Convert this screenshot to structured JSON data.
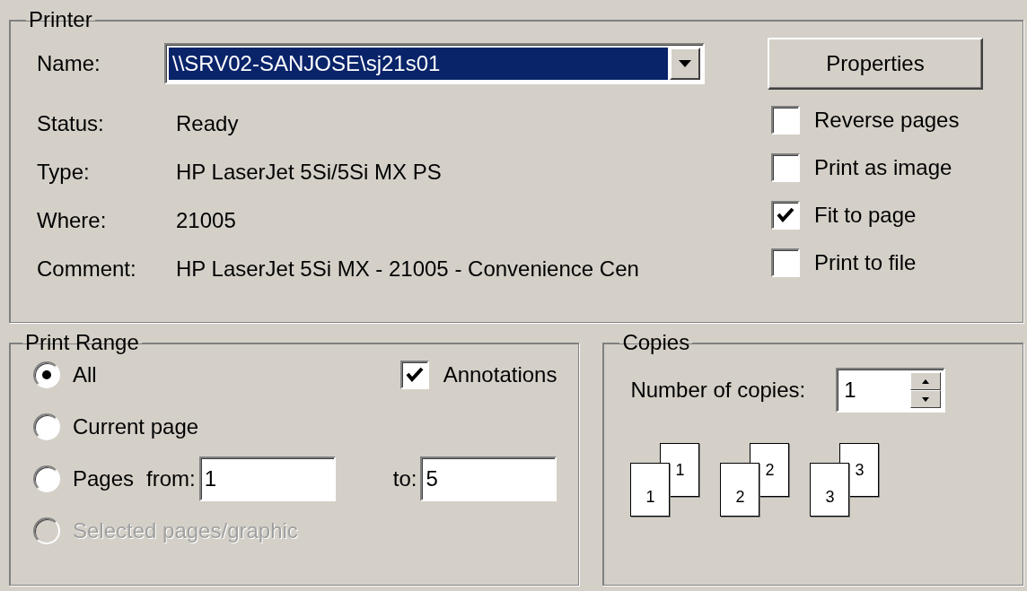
{
  "printer": {
    "title": "Printer",
    "name_label": "Name:",
    "name_value": "\\\\SRV02-SANJOSE\\sj21s01",
    "properties_button": "Properties",
    "info": [
      {
        "label": "Status:",
        "value": "Ready"
      },
      {
        "label": "Type:",
        "value": "HP LaserJet 5Si/5Si MX PS"
      },
      {
        "label": "Where:",
        "value": "21005"
      },
      {
        "label": "Comment:",
        "value": "HP LaserJet 5Si MX - 21005 - Convenience Cen"
      }
    ],
    "options": [
      {
        "label": "Reverse pages",
        "checked": false
      },
      {
        "label": "Print as image",
        "checked": false
      },
      {
        "label": "Fit to page",
        "checked": true
      },
      {
        "label": "Print to file",
        "checked": false
      }
    ]
  },
  "print_range": {
    "title": "Print Range",
    "options": [
      {
        "label": "All",
        "selected": true,
        "disabled": false
      },
      {
        "label": "Current page",
        "selected": false,
        "disabled": false
      },
      {
        "label": "Pages",
        "selected": false,
        "disabled": false
      },
      {
        "label": "Selected pages/graphic",
        "selected": false,
        "disabled": true
      }
    ],
    "annotations": {
      "label": "Annotations",
      "checked": true
    },
    "from_label": "from:",
    "from_value": "1",
    "to_label": "to:",
    "to_value": "5"
  },
  "copies": {
    "title": "Copies",
    "number_label": "Number of copies:",
    "number_value": "1",
    "collate_pages": [
      {
        "front": "1",
        "back": "1"
      },
      {
        "front": "2",
        "back": "2"
      },
      {
        "front": "3",
        "back": "3"
      }
    ]
  }
}
